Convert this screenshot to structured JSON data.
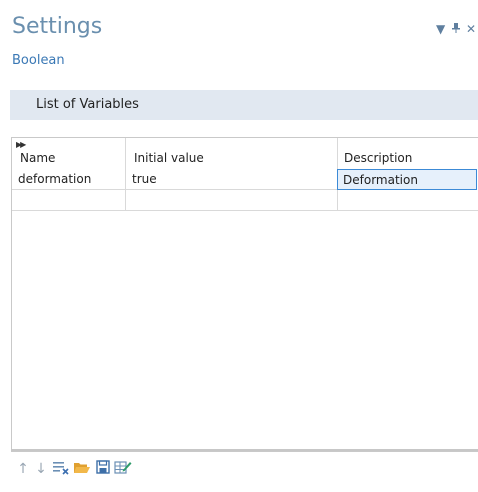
{
  "header": {
    "title": "Settings",
    "subtitle": "Boolean"
  },
  "window_controls": {
    "dropdown_icon": "▾",
    "pin_icon": "⬝",
    "close_icon": "×"
  },
  "section": {
    "label": "List of Variables"
  },
  "table": {
    "columns": [
      "Name",
      "Initial value",
      "Description"
    ],
    "rows": [
      {
        "name": "deformation",
        "initial_value": "true",
        "description": "Deformation"
      },
      {
        "name": "",
        "initial_value": "",
        "description": ""
      }
    ]
  },
  "toolbar": {
    "icons": [
      "arrow-up-icon",
      "arrow-down-icon",
      "clear-table-icon",
      "open-folder-icon",
      "save-icon",
      "edit-table-icon"
    ]
  },
  "colors": {
    "title": "#6a8fae",
    "subtitle": "#3a78b5",
    "section_bg": "#e1e8f1",
    "selection_border": "#3c8ad6",
    "selection_bg": "#e6f0fb"
  }
}
